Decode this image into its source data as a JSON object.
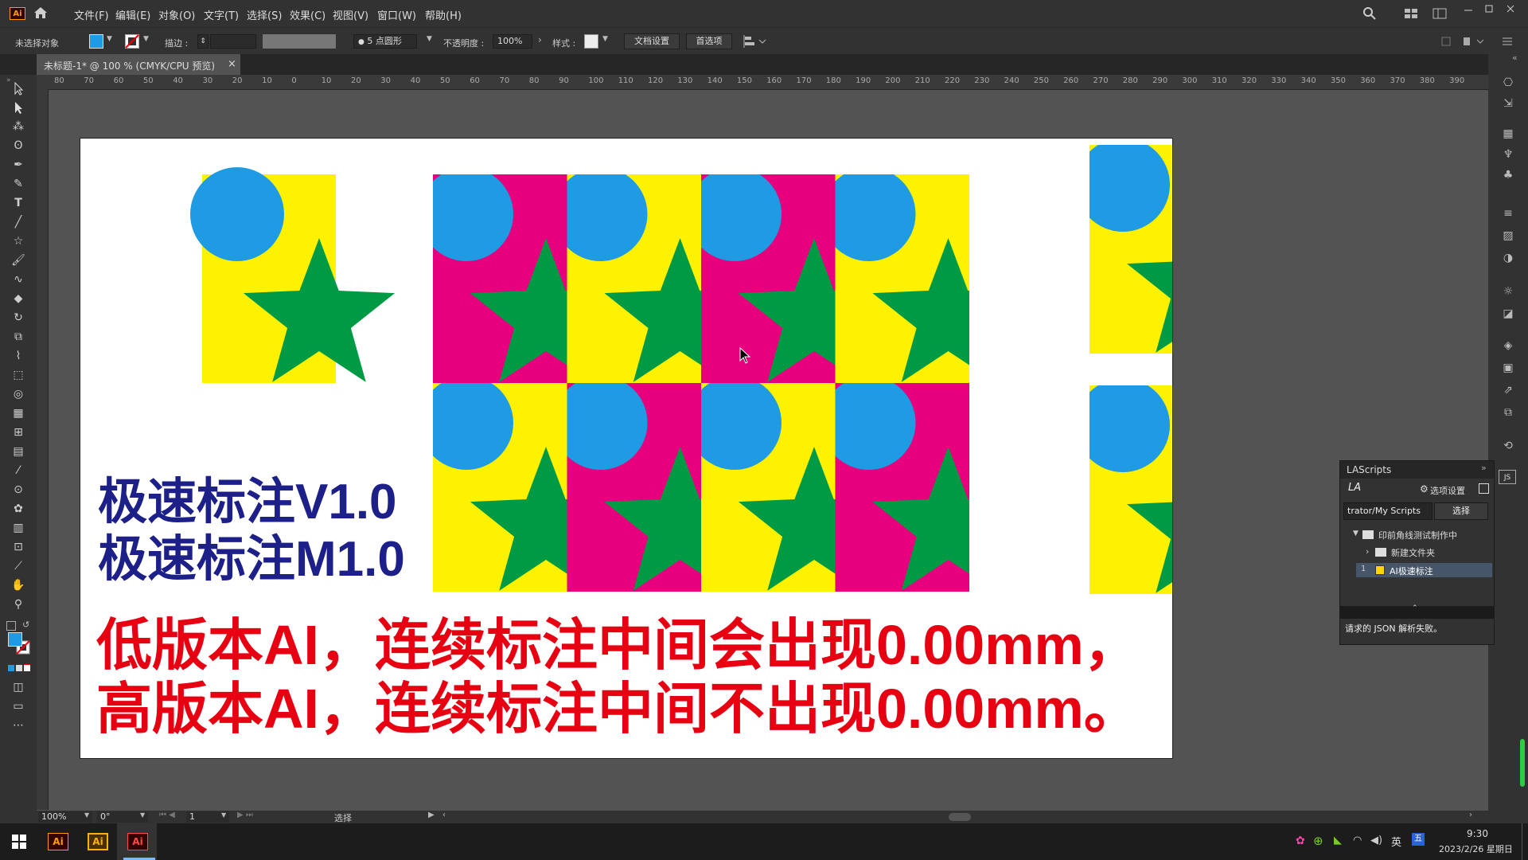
{
  "menubar": {
    "logo": "Ai",
    "items": [
      "文件(F)",
      "编辑(E)",
      "对象(O)",
      "文字(T)",
      "选择(S)",
      "效果(C)",
      "视图(V)",
      "窗口(W)",
      "帮助(H)"
    ]
  },
  "controlbar": {
    "selection_label": "未选择对象",
    "stroke_label": "描边 :",
    "brush_value": "5 点圆形",
    "opacity_label": "不透明度 :",
    "opacity_value": "100%",
    "style_label": "样式 :",
    "doc_setup_button": "文档设置",
    "preferences_button": "首选项"
  },
  "document_tab": {
    "title": "未标题-1* @ 100 % (CMYK/CPU 预览)",
    "close": "×"
  },
  "ruler": {
    "top_labels": [
      "80",
      "70",
      "60",
      "50",
      "40",
      "30",
      "20",
      "10",
      "0",
      "10",
      "20",
      "30",
      "40",
      "50",
      "60",
      "70",
      "80",
      "90",
      "100",
      "110",
      "120",
      "130",
      "140",
      "150",
      "160",
      "170",
      "180",
      "190",
      "200",
      "210",
      "220",
      "230",
      "240",
      "250",
      "260",
      "270",
      "280",
      "290",
      "300",
      "310",
      "320",
      "330",
      "340",
      "350",
      "360",
      "370",
      "380",
      "390"
    ]
  },
  "canvas": {
    "heading_line1": "极速标注V1.0",
    "heading_line2": "极速标注M1.0",
    "note_line1": "低版本AI，连续标注中间会出现0.00mm，",
    "note_line2": "高版本AI，连续标注中间不出现0.00mm。",
    "colors": {
      "yellow": "#fff200",
      "magenta": "#e6007e",
      "cyan": "#1e9be3",
      "green": "#009a44",
      "navy": "#1d2088",
      "red": "#e60012"
    },
    "grid_bg_colors": [
      [
        "magenta",
        "yellow",
        "magenta",
        "yellow"
      ],
      [
        "yellow",
        "magenta",
        "yellow",
        "magenta"
      ]
    ]
  },
  "lascripts": {
    "title": "LAScripts",
    "logo": "LA",
    "settings_label": "选项设置",
    "path_label": "trator/My Scripts",
    "select_button": "选择",
    "tree": [
      {
        "label": "印前角线测试制作中",
        "level": 0,
        "expanded": true
      },
      {
        "label": "新建文件夹",
        "level": 1,
        "expanded": false
      },
      {
        "label": "AI极速标注",
        "level": 1,
        "number": "1",
        "selected": true
      }
    ],
    "status": "请求的 JSON 解析失败。"
  },
  "statusbar": {
    "zoom": "100%",
    "rotation": "0°",
    "artboard_number": "1",
    "tool_name": "选择"
  },
  "taskbar": {
    "apps": [
      "Ai",
      "Ai",
      "Ai"
    ],
    "ime": "英",
    "time": "9:30",
    "date": "2023/2/26 星期日"
  }
}
